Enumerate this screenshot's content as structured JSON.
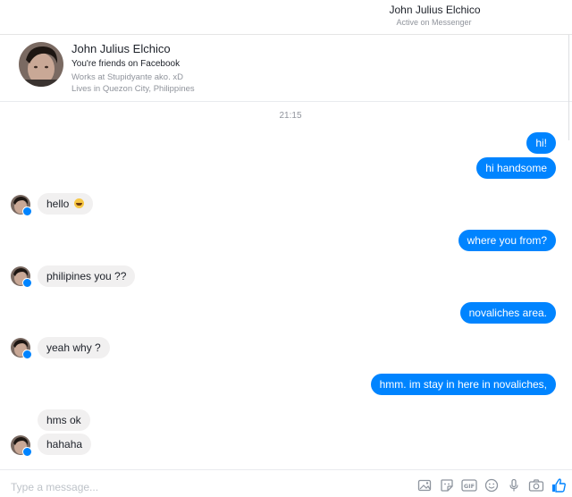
{
  "header": {
    "name": "John Julius Elchico",
    "status": "Active on Messenger"
  },
  "profile": {
    "name": "John Julius Elchico",
    "friends": "You're friends on Facebook",
    "work": "Works at Stupidyante ako. xD",
    "lives": "Lives in Quezon City, Philippines"
  },
  "timestamp": "21:15",
  "messages": [
    {
      "text": "hi!",
      "from": "me"
    },
    {
      "text": "hi handsome",
      "from": "me"
    },
    {
      "text": "hello",
      "from": "them",
      "emoji": "grinning-face-icon"
    },
    {
      "text": "where you from?",
      "from": "me"
    },
    {
      "text": "philipines you ??",
      "from": "them"
    },
    {
      "text": "novaliches area.",
      "from": "me"
    },
    {
      "text": "yeah why ?",
      "from": "them"
    },
    {
      "text": "hmm. im stay in here in novaliches,",
      "from": "me"
    },
    {
      "text": "hms ok",
      "from": "them"
    },
    {
      "text": "hahaha",
      "from": "them"
    }
  ],
  "composer": {
    "placeholder": "Type a message...",
    "tools": [
      "image-icon",
      "sticker-icon",
      "gif-icon",
      "emoji-icon",
      "microphone-icon",
      "camera-icon",
      "like-icon"
    ]
  },
  "colors": {
    "accent": "#0084ff",
    "incoming_bubble": "#f1f0f0",
    "muted_text": "#90949c"
  }
}
